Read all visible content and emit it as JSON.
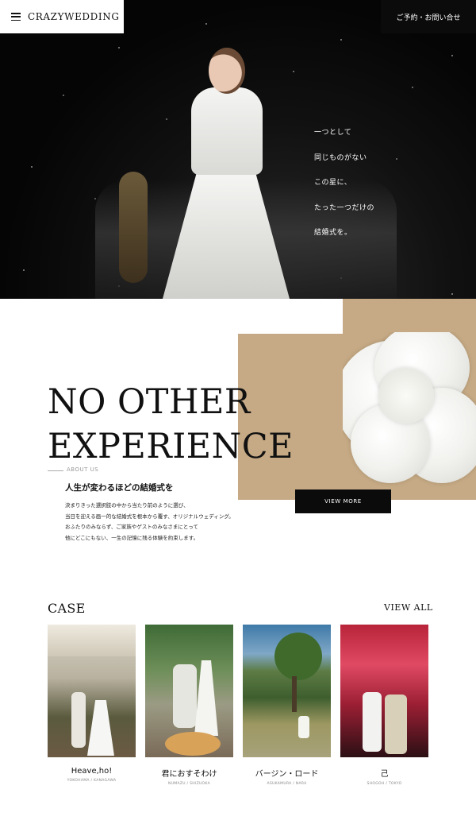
{
  "header": {
    "logo": "CRAZYWEDDING",
    "reserve_button": "ご予約・お問い合せ"
  },
  "hero": {
    "poem": [
      "一つとして",
      "同じものがない",
      "この星に、",
      "たった一つだけの",
      "結婚式を。"
    ]
  },
  "about": {
    "headline_line1": "NO OTHER",
    "headline_line2": "EXPERIENCE",
    "section_label": "ABOUT US",
    "subhead": "人生が変わるほどの結婚式を",
    "body": [
      "決まりきった選択肢の中から当たり前のように選び、",
      "当日を迎える画一的な結婚式を根本から覆す、オリジナルウェディング。",
      "おふたりのみならず、ご家族やゲストのみなさまにとって",
      "他にどこにもない、一生の記憶に残る体験を約束します。"
    ],
    "view_more": "VIEW MORE"
  },
  "case": {
    "title": "CASE",
    "view_all": "VIEW ALL",
    "items": [
      {
        "title": "Heave,ho!",
        "location": "YOKOHAMA / KANAGAWA"
      },
      {
        "title": "君におすそわけ",
        "location": "NUMAZU / SHIZUOKA"
      },
      {
        "title": "バージン・ロード",
        "location": "ASUKAMURA / NARA"
      },
      {
        "title": "己",
        "location": "SHOGOH / TOKYO"
      }
    ]
  }
}
